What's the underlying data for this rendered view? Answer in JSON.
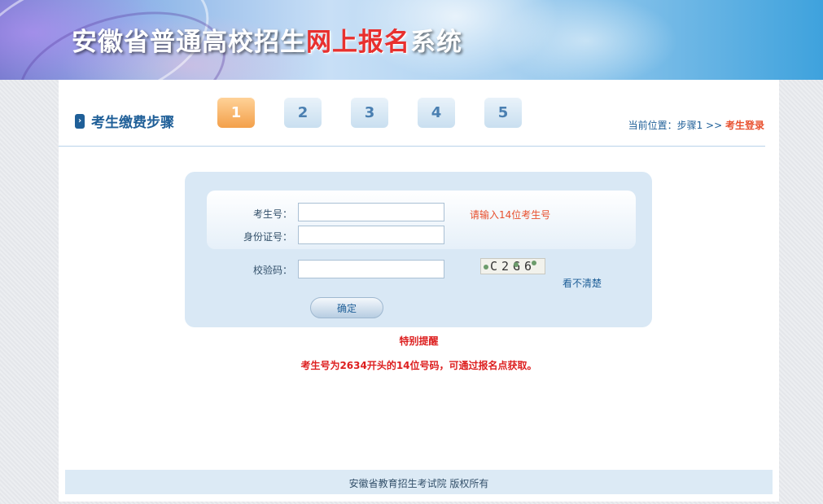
{
  "banner": {
    "title_prefix": "安徽省普通高校招生",
    "title_highlight": "网上报名",
    "title_suffix": "系统"
  },
  "header": {
    "section_title": "考生缴费步骤",
    "steps": [
      "1",
      "2",
      "3",
      "4",
      "5"
    ],
    "active_step": 1,
    "breadcrumb_prefix": "当前位置：步骤1 >> ",
    "breadcrumb_current": "考生登录"
  },
  "form": {
    "exam_id_label": "考生号：",
    "exam_id_value": "",
    "exam_id_hint": "请输入14位考生号",
    "id_card_label": "身份证号：",
    "id_card_value": "",
    "captcha_label": "校验码：",
    "captcha_value": "",
    "captcha_text": "C2G6",
    "refresh_link": "看不清楚",
    "submit_label": "确定"
  },
  "notice": {
    "title": "特别提醒",
    "text": "考生号为2634开头的14位号码，可通过报名点获取。"
  },
  "footer": {
    "copyright": "安徽省教育招生考试院 版权所有"
  },
  "colors": {
    "accent": "#1f5f98",
    "highlight": "#e8502e",
    "alert": "#dd1f1f",
    "active_step": "#f3a04a"
  }
}
